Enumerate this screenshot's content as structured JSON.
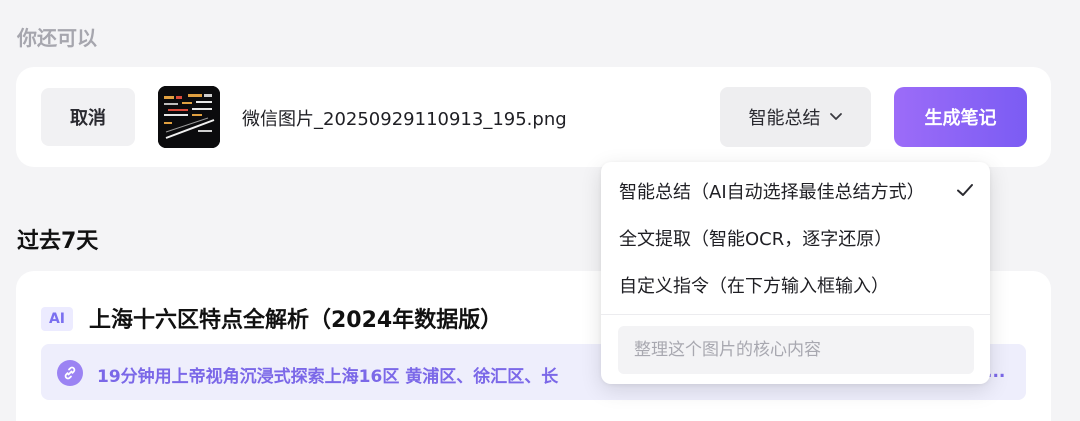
{
  "section_label": "你还可以",
  "upload": {
    "cancel_label": "取消",
    "file_name": "微信图片_20250929110913_195.png",
    "mode_selected": "智能总结",
    "generate_label": "生成笔记"
  },
  "dropdown": {
    "items": [
      {
        "label": "智能总结（AI自动选择最佳总结方式）",
        "selected": true
      },
      {
        "label": "全文提取（智能OCR，逐字还原）",
        "selected": false
      },
      {
        "label": "自定义指令（在下方输入框输入）",
        "selected": false
      }
    ],
    "input_placeholder": "整理这个图片的核心内容"
  },
  "history": {
    "title": "过去7天",
    "notes": [
      {
        "badge": "AI",
        "title": "上海十六区特点全解析（2024年数据版）",
        "link_text": "19分钟用上帝视角沉浸式探索上海16区 黄浦区、徐汇区、长",
        "link_ellipsis": "..."
      }
    ]
  },
  "colors": {
    "accent": "#7b5cf3",
    "link_text": "#7b68e8",
    "page_bg": "#f4f4f6"
  }
}
